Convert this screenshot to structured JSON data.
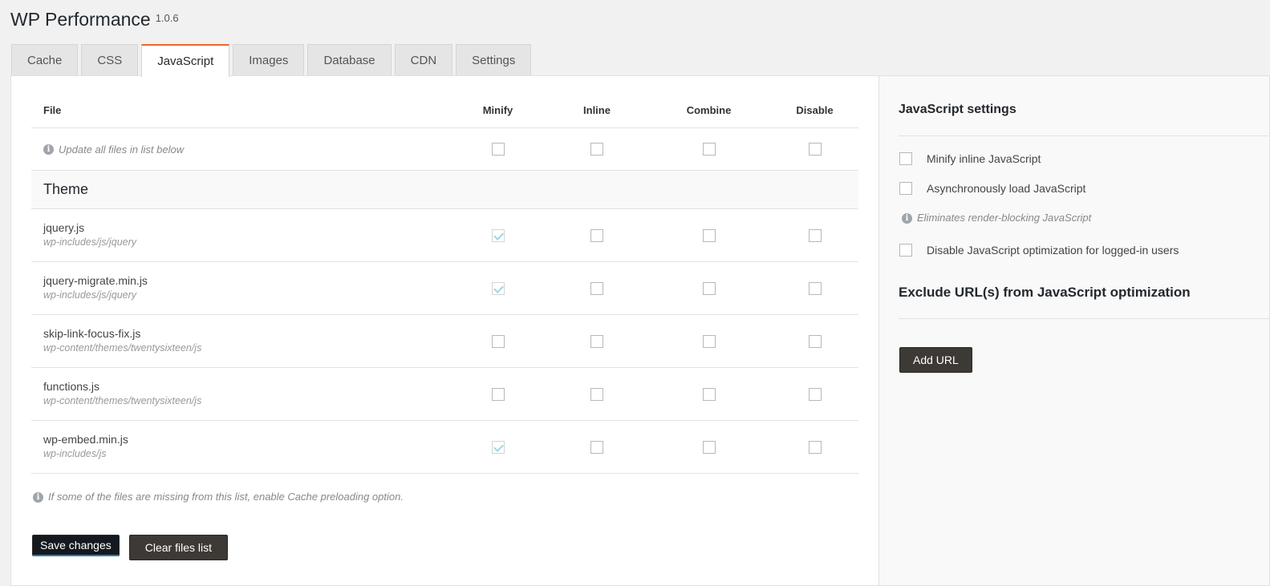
{
  "app": {
    "title": "WP Performance",
    "version": "1.0.6"
  },
  "tabs": [
    {
      "label": "Cache"
    },
    {
      "label": "CSS"
    },
    {
      "label": "JavaScript",
      "active": true
    },
    {
      "label": "Images"
    },
    {
      "label": "Database"
    },
    {
      "label": "CDN"
    },
    {
      "label": "Settings"
    }
  ],
  "table": {
    "headers": {
      "file": "File",
      "minify": "Minify",
      "inline": "Inline",
      "combine": "Combine",
      "disable": "Disable"
    },
    "update_all_hint": "Update all files in list below",
    "group_title": "Theme",
    "files": [
      {
        "name": "jquery.js",
        "path": "wp-includes/js/jquery",
        "minify": true,
        "inline": false,
        "combine": false,
        "disable": false
      },
      {
        "name": "jquery-migrate.min.js",
        "path": "wp-includes/js/jquery",
        "minify": true,
        "inline": false,
        "combine": false,
        "disable": false
      },
      {
        "name": "skip-link-focus-fix.js",
        "path": "wp-content/themes/twentysixteen/js",
        "minify": false,
        "inline": false,
        "combine": false,
        "disable": false
      },
      {
        "name": "functions.js",
        "path": "wp-content/themes/twentysixteen/js",
        "minify": false,
        "inline": false,
        "combine": false,
        "disable": false
      },
      {
        "name": "wp-embed.min.js",
        "path": "wp-includes/js",
        "minify": true,
        "inline": false,
        "combine": false,
        "disable": false
      }
    ]
  },
  "missing_note": "If some of the files are missing from this list, enable Cache preloading option.",
  "buttons": {
    "save": "Save changes",
    "clear": "Clear files list"
  },
  "sidebar": {
    "settings_title": "JavaScript settings",
    "minify_inline": "Minify inline JavaScript",
    "async_load": "Asynchronously load JavaScript",
    "async_hint": "Eliminates render-blocking JavaScript",
    "disable_logged_in": "Disable JavaScript optimization for logged-in users",
    "exclude_title": "Exclude URL(s) from JavaScript optimization",
    "add_url": "Add URL"
  },
  "colors": {
    "accent_tab": "#f0652b",
    "button_dark": "#3d3935",
    "checkmark": "#9ed6e6"
  }
}
